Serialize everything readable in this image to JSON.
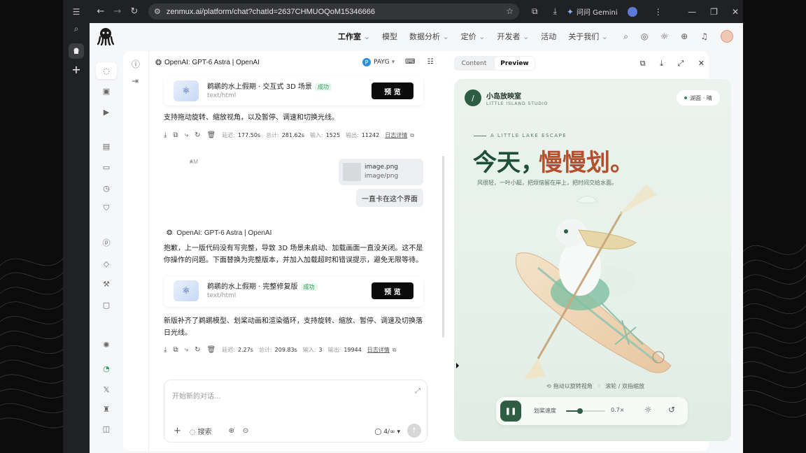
{
  "browser": {
    "url": "zenmux.ai/platform/chat?chatId=2637CHMUOQoM15346666",
    "gemini_label": "问问 Gemini"
  },
  "nav": {
    "menu": [
      "工作室",
      "模型",
      "数据分析",
      "定价",
      "开发者",
      "活动",
      "关于我们"
    ],
    "menu_has_dropdown": [
      true,
      false,
      true,
      true,
      true,
      false,
      true
    ]
  },
  "chat": {
    "model_title": "OpenAI: GPT-6 Astra | OpenAI",
    "model_time": "AM",
    "billing": "PAYG",
    "artifacts": [
      {
        "title": "鹈鹕的水上假期 · 交互式 3D 场景",
        "type": "text/html",
        "status": "成功",
        "preview": "预 览"
      },
      {
        "title": "鹈鹕的水上假期 · 完整修复版",
        "type": "text/html",
        "status": "成功",
        "preview": "预 览"
      }
    ],
    "msg1": "支持拖动旋转、缩放视角，以及暂停、调速和切换光线。",
    "stats1": {
      "label1": "延迟:",
      "val1": "177.50s",
      "label2": "总计:",
      "val2": "281.62s",
      "label3": "输入:",
      "val3": "1525",
      "label4": "输出:",
      "val4": "11242",
      "link": "日志详情"
    },
    "attachment": {
      "name": "image.png",
      "mime": "image/png"
    },
    "user_msg": "一直卡在这个界面",
    "ai_name": "OpenAI: GPT-6 Astra | OpenAI",
    "ai_reply": "抱歉，上一版代码没有写完整，导致 3D 场景未启动、加载画面一直没关闭。这不是你操作的问题。下面替换为完整版本，并加入加载超时和错误提示，避免无限等待。",
    "msg2": "新版补齐了鹈鹕模型、划桨动画和渲染循环，支持旋转、缩放、暂停、调速及切换落日光线。",
    "stats2": {
      "label1": "延迟:",
      "val1": "2.27s",
      "label2": "总计:",
      "val2": "209.83s",
      "label3": "输入:",
      "val3": "3",
      "label4": "输出:",
      "val4": "19944",
      "link": "日志详情"
    },
    "input_placeholder": "开始新的对话...",
    "tool_search": "搜索",
    "counter": "4/∞"
  },
  "preview": {
    "tab_content": "Content",
    "tab_preview": "Preview",
    "brand_name": "小岛放映室",
    "brand_sub": "LITTLE ISLAND STUDIO",
    "pill": "湖面 · 晴",
    "escape": "A LITTLE LAKE ESCAPE",
    "hero_a": "今天，",
    "hero_b": "慢慢划。",
    "subline": "风很轻，一叶小艇，把烦恼留在岸上，把时间交给水面。",
    "controls_hint": "拖动以旋转视角　·　滚轮 / 双指缩放",
    "speed_label": "划桨速度",
    "speed_value": "0.7×",
    "speed_level": 0.35
  }
}
